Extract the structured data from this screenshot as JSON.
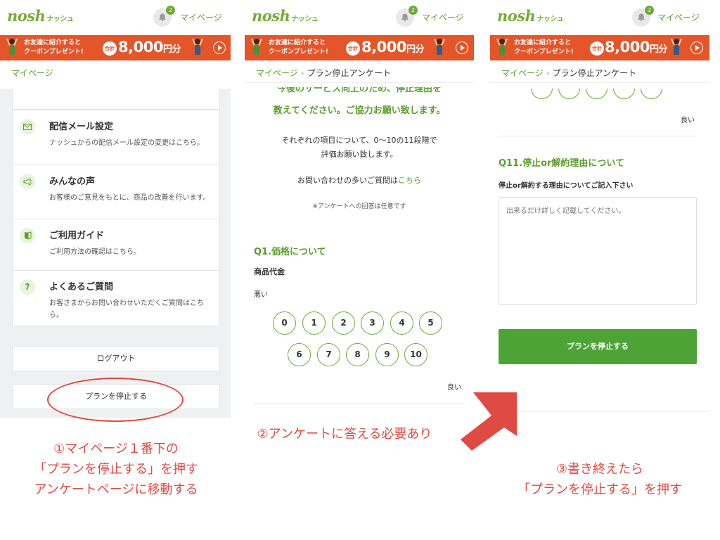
{
  "header": {
    "logo": "nosh",
    "logo_sub": "ナッシュ",
    "notification_count": "2",
    "mypage_label": "マイページ"
  },
  "banner": {
    "line1": "お友達に紹介すると",
    "line2": "クーポンプレゼント!",
    "total_label": "合計",
    "amount": "8,000",
    "amount_suffix": "円分"
  },
  "panel1": {
    "breadcrumb": "マイページ",
    "menu_items": [
      {
        "icon": "mail-icon",
        "title": "配信メール設定",
        "desc": "ナッシュからの配信メール設定の変更はこちら。"
      },
      {
        "icon": "megaphone-icon",
        "title": "みんなの声",
        "desc": "お客様のご意見をもとに、商品の改善を行います。"
      },
      {
        "icon": "guide-book-icon",
        "title": "ご利用ガイド",
        "desc": "ご利用方法の確認はこちら。"
      },
      {
        "icon": "question-icon",
        "title": "よくあるご質問",
        "desc": "お客さまからお問い合わせいただくご質問はこちら。"
      }
    ],
    "logout_label": "ログアウト",
    "stop_label": "プランを停止する"
  },
  "panel2": {
    "breadcrumb_home": "マイページ",
    "breadcrumb_current": "プラン停止アンケート",
    "lead_line1": "今後のサービス向上のため、停止理由を",
    "lead_line2": "教えてください。ご協力お願い致します。",
    "desc_line1": "それぞれの項目について、0〜10の11段階で",
    "desc_line2": "評価お願い致します。",
    "faq_text": "お問い合わせの多いご質問は",
    "faq_link": "こちら",
    "note": "※アンケートへの回答は任意です",
    "q1_title": "Q1.価格について",
    "q1_sub": "商品代金",
    "scale_low": "悪い",
    "scale_high": "良い",
    "scale": [
      "0",
      "1",
      "2",
      "3",
      "4",
      "5",
      "6",
      "7",
      "8",
      "9",
      "10"
    ]
  },
  "panel3": {
    "breadcrumb_home": "マイページ",
    "breadcrumb_current": "プラン停止アンケート",
    "scale_high": "良い",
    "q11_title": "Q11.停止or解約理由について",
    "q11_sub": "停止or解約する理由についてご記入下さい",
    "placeholder": "出来るだけ詳しく記載してください。",
    "submit_label": "プランを停止する"
  },
  "captions": {
    "step1_line1": "①マイページ１番下の",
    "step1_line2": "「プランを停止する」を押す",
    "step1_line3": "アンケートページに移動する",
    "step2": "②アンケートに答える必要あり",
    "step3_line1": "③書き終えたら",
    "step3_line2": "「プランを停止する」を押す"
  },
  "colors": {
    "brand_green": "#5a9e2b",
    "button_green": "#4da336",
    "banner_orange": "#e45529",
    "annotation_red": "#e04a44"
  }
}
